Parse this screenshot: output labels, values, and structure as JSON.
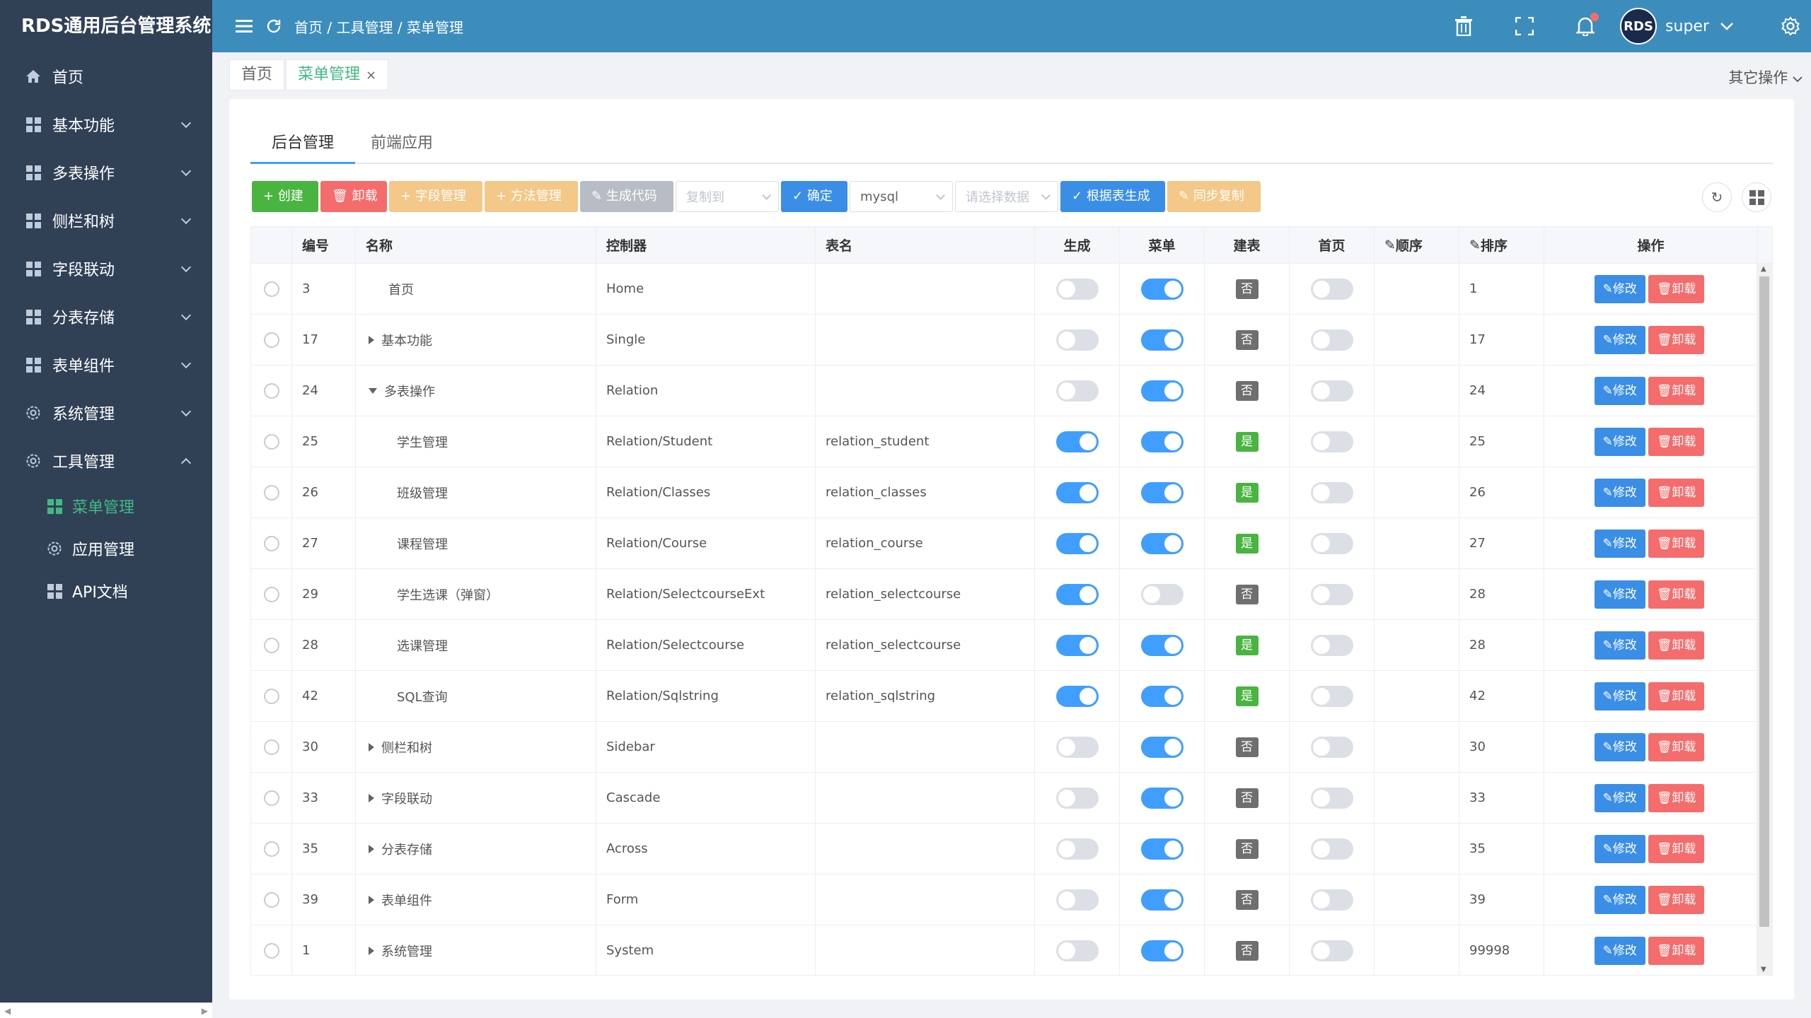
{
  "app": {
    "title": "RDS通用后台管理系统"
  },
  "sidebar": {
    "items": [
      {
        "label": "首页",
        "icon": "home-icon",
        "expandable": false
      },
      {
        "label": "基本功能",
        "icon": "grid-icon",
        "expandable": true
      },
      {
        "label": "多表操作",
        "icon": "grid-icon",
        "expandable": true
      },
      {
        "label": "侧栏和树",
        "icon": "grid-icon",
        "expandable": true
      },
      {
        "label": "字段联动",
        "icon": "grid-icon",
        "expandable": true
      },
      {
        "label": "分表存储",
        "icon": "grid-icon",
        "expandable": true
      },
      {
        "label": "表单组件",
        "icon": "grid-icon",
        "expandable": true
      },
      {
        "label": "系统管理",
        "icon": "gear-icon",
        "expandable": true
      },
      {
        "label": "工具管理",
        "icon": "gear-icon",
        "expandable": true,
        "expanded": true
      }
    ],
    "subitems": [
      {
        "label": "菜单管理",
        "icon": "grid-icon",
        "active": true
      },
      {
        "label": "应用管理",
        "icon": "gear-icon",
        "active": false
      },
      {
        "label": "API文档",
        "icon": "grid-icon",
        "active": false
      }
    ]
  },
  "header": {
    "breadcrumb": [
      "首页",
      "工具管理",
      "菜单管理"
    ],
    "separator": "/",
    "user": {
      "name": "super",
      "avatar_text": "RDS"
    }
  },
  "page_tabs": [
    {
      "label": "首页",
      "active": false
    },
    {
      "label": "菜单管理",
      "active": true,
      "close": "×"
    }
  ],
  "other_ops": "其它操作",
  "inner_tabs": [
    {
      "label": "后台管理",
      "active": true
    },
    {
      "label": "前端应用",
      "active": false
    }
  ],
  "toolbar": {
    "create": "+ 创建",
    "uninstall": "卸载",
    "field_mgmt": "+ 字段管理",
    "method_mgmt": "+ 方法管理",
    "gen_code": "生成代码",
    "copy_to_placeholder": "复制到",
    "confirm": "确定",
    "db_select": "mysql",
    "table_select_placeholder": "请选择数据",
    "gen_from_table": "根据表生成",
    "sync_copy": "同步复制"
  },
  "table": {
    "columns": [
      "编号",
      "名称",
      "控制器",
      "表名",
      "生成",
      "菜单",
      "建表",
      "首页",
      "顺序",
      "排序",
      "操作"
    ],
    "edit_label": "修改",
    "delete_label": "卸载",
    "yes": "是",
    "no": "否",
    "rows": [
      {
        "id": "3",
        "name": "首页",
        "level": 0,
        "tree": "none",
        "controller": "Home",
        "table": "",
        "gen": false,
        "menu": true,
        "build": false,
        "home": false,
        "sort": "1"
      },
      {
        "id": "17",
        "name": "基本功能",
        "level": 0,
        "tree": "collapsed",
        "controller": "Single",
        "table": "",
        "gen": false,
        "menu": true,
        "build": false,
        "home": false,
        "sort": "17"
      },
      {
        "id": "24",
        "name": "多表操作",
        "level": 0,
        "tree": "expanded",
        "controller": "Relation",
        "table": "",
        "gen": false,
        "menu": true,
        "build": false,
        "home": false,
        "sort": "24"
      },
      {
        "id": "25",
        "name": "学生管理",
        "level": 1,
        "tree": "none",
        "controller": "Relation/Student",
        "table": "relation_student",
        "gen": true,
        "menu": true,
        "build": true,
        "home": false,
        "sort": "25"
      },
      {
        "id": "26",
        "name": "班级管理",
        "level": 1,
        "tree": "none",
        "controller": "Relation/Classes",
        "table": "relation_classes",
        "gen": true,
        "menu": true,
        "build": true,
        "home": false,
        "sort": "26"
      },
      {
        "id": "27",
        "name": "课程管理",
        "level": 1,
        "tree": "none",
        "controller": "Relation/Course",
        "table": "relation_course",
        "gen": true,
        "menu": true,
        "build": true,
        "home": false,
        "sort": "27"
      },
      {
        "id": "29",
        "name": "学生选课（弹窗）",
        "level": 1,
        "tree": "none",
        "controller": "Relation/SelectcourseExt",
        "table": "relation_selectcourse",
        "gen": true,
        "menu": false,
        "build": false,
        "home": false,
        "sort": "28"
      },
      {
        "id": "28",
        "name": "选课管理",
        "level": 1,
        "tree": "none",
        "controller": "Relation/Selectcourse",
        "table": "relation_selectcourse",
        "gen": true,
        "menu": true,
        "build": true,
        "home": false,
        "sort": "28"
      },
      {
        "id": "42",
        "name": "SQL查询",
        "level": 1,
        "tree": "none",
        "controller": "Relation/Sqlstring",
        "table": "relation_sqlstring",
        "gen": true,
        "menu": true,
        "build": true,
        "home": false,
        "sort": "42"
      },
      {
        "id": "30",
        "name": "侧栏和树",
        "level": 0,
        "tree": "collapsed",
        "controller": "Sidebar",
        "table": "",
        "gen": false,
        "menu": true,
        "build": false,
        "home": false,
        "sort": "30"
      },
      {
        "id": "33",
        "name": "字段联动",
        "level": 0,
        "tree": "collapsed",
        "controller": "Cascade",
        "table": "",
        "gen": false,
        "menu": true,
        "build": false,
        "home": false,
        "sort": "33"
      },
      {
        "id": "35",
        "name": "分表存储",
        "level": 0,
        "tree": "collapsed",
        "controller": "Across",
        "table": "",
        "gen": false,
        "menu": true,
        "build": false,
        "home": false,
        "sort": "35"
      },
      {
        "id": "39",
        "name": "表单组件",
        "level": 0,
        "tree": "collapsed",
        "controller": "Form",
        "table": "",
        "gen": false,
        "menu": true,
        "build": false,
        "home": false,
        "sort": "39"
      },
      {
        "id": "1",
        "name": "系统管理",
        "level": 0,
        "tree": "collapsed",
        "controller": "System",
        "table": "",
        "gen": false,
        "menu": true,
        "build": false,
        "home": false,
        "sort": "99998"
      }
    ]
  },
  "colors": {
    "sidebar_bg": "#304156",
    "header_bg": "#3c8dbc",
    "accent_green": "#42b983",
    "primary_blue": "#409eff",
    "danger_red": "#f56c6c"
  }
}
